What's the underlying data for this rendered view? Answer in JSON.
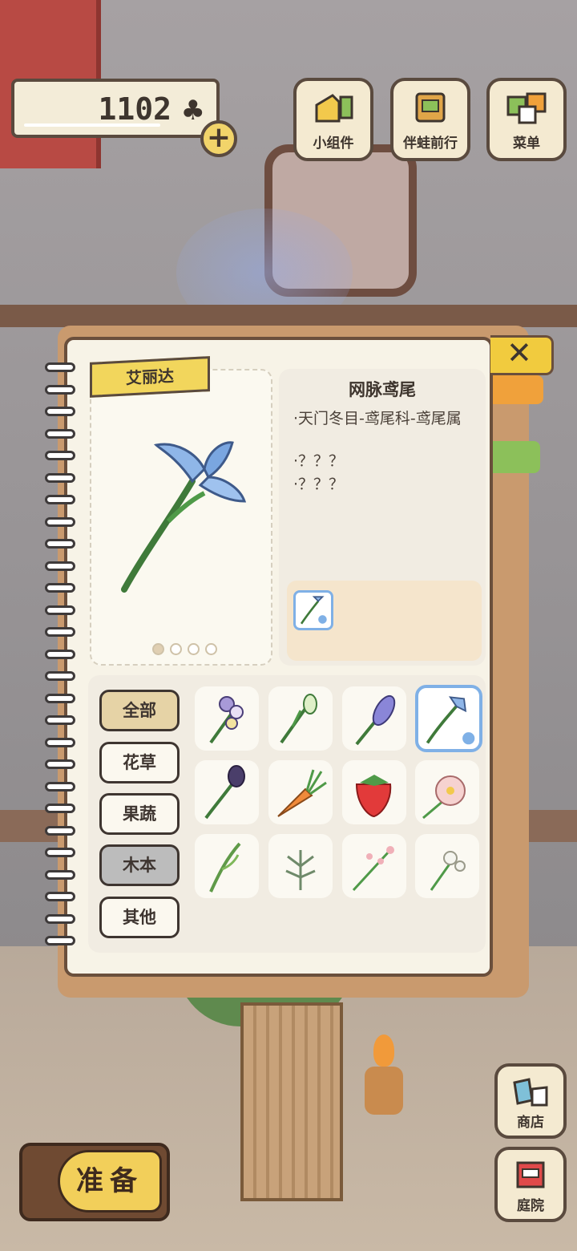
{
  "hud": {
    "clover_count": "1102",
    "clover_icon": "clover-icon",
    "buttons": [
      {
        "label": "小组件",
        "icon": "widget-icon"
      },
      {
        "label": "伴蛙前行",
        "icon": "companion-icon"
      },
      {
        "label": "菜单",
        "icon": "menu-icon"
      }
    ]
  },
  "notebook": {
    "name_tag": "艾丽达",
    "flower_title": "网脉鸢尾",
    "info_lines": [
      "·天门冬目-鸢尾科-鸢尾属",
      "·？？？",
      "·？？？"
    ],
    "page_dots": 4,
    "active_dot": 0,
    "categories": [
      {
        "label": "全部",
        "state": "selected"
      },
      {
        "label": "花草",
        "state": "normal"
      },
      {
        "label": "果蔬",
        "state": "normal"
      },
      {
        "label": "木本",
        "state": "dark"
      },
      {
        "label": "其他",
        "state": "normal"
      }
    ],
    "items": [
      {
        "icon": "pansy-icon"
      },
      {
        "icon": "white-flower-icon"
      },
      {
        "icon": "hyacinth-icon"
      },
      {
        "icon": "blue-iris-icon",
        "selected": true
      },
      {
        "icon": "purple-tulip-icon"
      },
      {
        "icon": "carrot-icon"
      },
      {
        "icon": "strawberry-icon"
      },
      {
        "icon": "pink-blossom-icon"
      },
      {
        "icon": "green-sprout-icon"
      },
      {
        "icon": "herb-icon"
      },
      {
        "icon": "pink-sprig-icon"
      },
      {
        "icon": "white-clover-flower-icon"
      }
    ]
  },
  "bottom": {
    "ready_label": "准备",
    "shop_label": "商店",
    "yard_label": "庭院"
  },
  "colors": {
    "accent_blue": "#7fb0e6",
    "tag_yellow": "#f2d65c",
    "paper": "#f7f3e7"
  }
}
